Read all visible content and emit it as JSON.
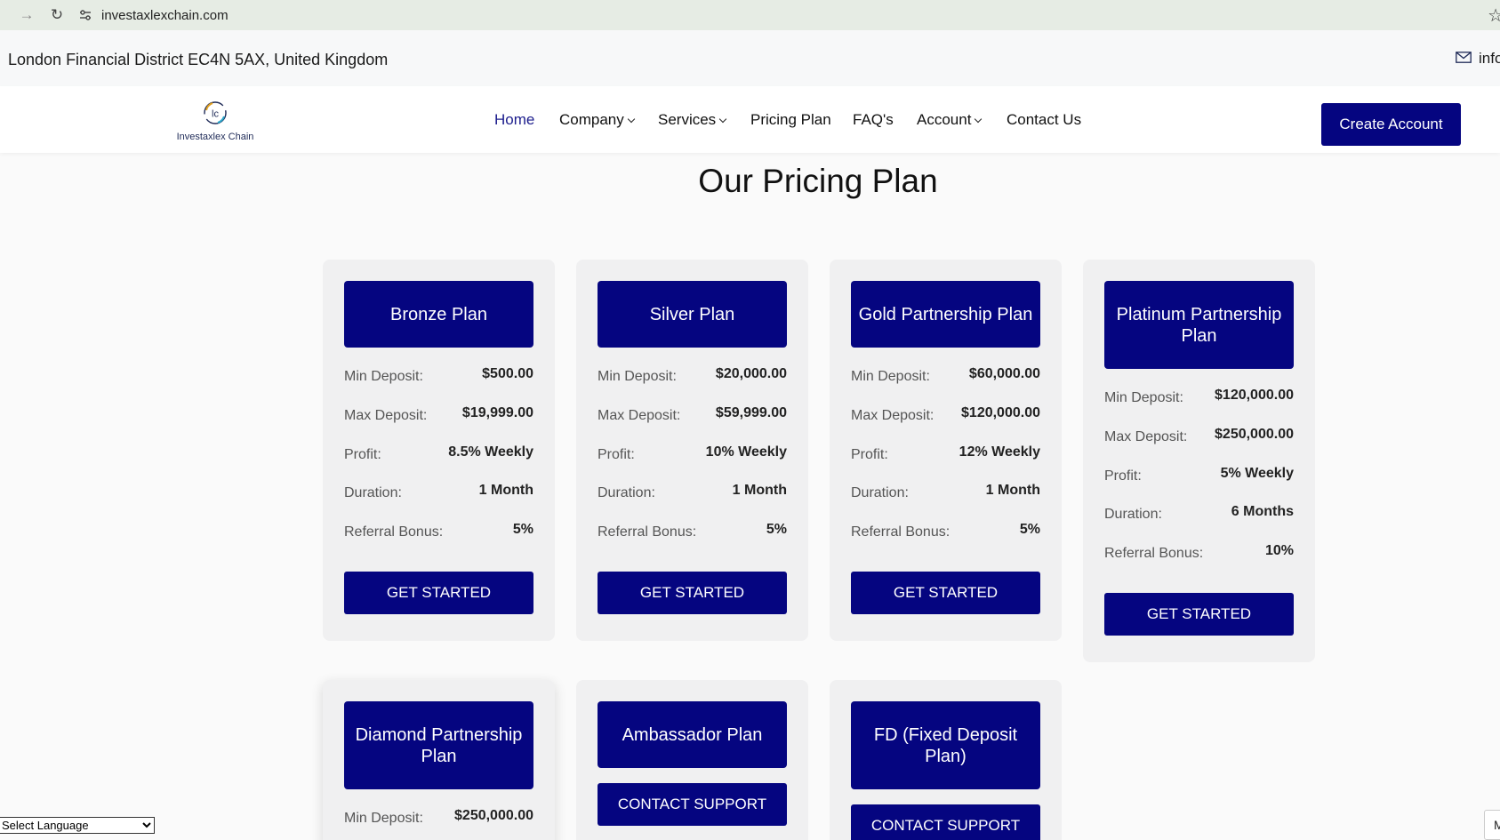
{
  "browser": {
    "url": "investaxlexchain.com"
  },
  "topbar": {
    "address": "London Financial District EC4N 5AX, United Kingdom",
    "email_partial": "info"
  },
  "logo": {
    "text": "Investaxlex Chain"
  },
  "nav": {
    "items": [
      {
        "label": "Home"
      },
      {
        "label": "Company"
      },
      {
        "label": "Services"
      },
      {
        "label": "Pricing Plan"
      },
      {
        "label": "FAQ's"
      },
      {
        "label": "Account"
      },
      {
        "label": "Contact Us"
      }
    ],
    "create_account": "Create Account"
  },
  "page_title": "Our Pricing Plan",
  "labels": {
    "min_deposit": "Min Deposit:",
    "max_deposit": "Max Deposit:",
    "profit": "Profit:",
    "duration": "Duration:",
    "referral_bonus": "Referral Bonus:"
  },
  "plans": [
    {
      "name": "Bronze Plan",
      "min_deposit": "$500.00",
      "max_deposit": "$19,999.00",
      "profit": "8.5% Weekly",
      "duration": "1 Month",
      "referral_bonus": "5%",
      "cta": "GET STARTED"
    },
    {
      "name": "Silver Plan",
      "min_deposit": "$20,000.00",
      "max_deposit": "$59,999.00",
      "profit": "10% Weekly",
      "duration": "1 Month",
      "referral_bonus": "5%",
      "cta": "GET STARTED"
    },
    {
      "name": "Gold Partnership Plan",
      "min_deposit": "$60,000.00",
      "max_deposit": "$120,000.00",
      "profit": "12% Weekly",
      "duration": "1 Month",
      "referral_bonus": "5%",
      "cta": "GET STARTED"
    },
    {
      "name": "Platinum Partnership Plan",
      "min_deposit": "$120,000.00",
      "max_deposit": "$250,000.00",
      "profit": "5% Weekly",
      "duration": "6 Months",
      "referral_bonus": "10%",
      "cta": "GET STARTED"
    },
    {
      "name": "Diamond Partnership Plan",
      "min_deposit": "$250,000.00"
    },
    {
      "name": "Ambassador Plan",
      "cta": "CONTACT SUPPORT"
    },
    {
      "name": "FD (Fixed Deposit Plan)",
      "cta": "CONTACT SUPPORT"
    }
  ],
  "language_select": {
    "selected": "Select Language"
  },
  "corner_widget": {
    "text": "M"
  }
}
